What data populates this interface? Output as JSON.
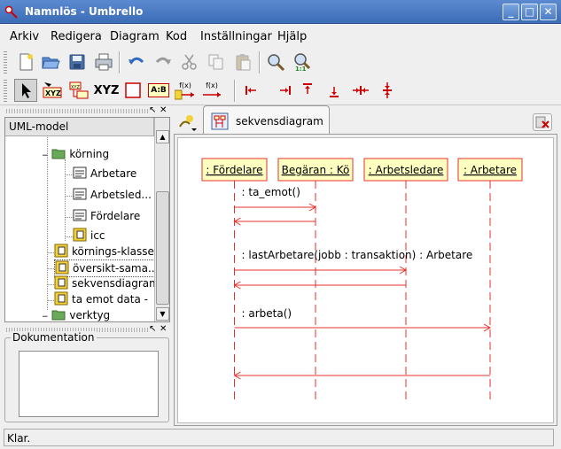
{
  "window": {
    "title": "Namnlös - Umbrello",
    "buttons": {
      "minimize": "_",
      "maximize": "□",
      "close": "✕"
    }
  },
  "menubar": {
    "items": [
      {
        "label": "Arkiv"
      },
      {
        "label": "Redigera"
      },
      {
        "label": "Diagram"
      },
      {
        "label": "Kod"
      },
      {
        "label": "Inställningar"
      },
      {
        "label": "Hjälp"
      }
    ]
  },
  "toolbar2": {
    "text_tool_label": "XYZ",
    "fx1": "f(x)",
    "fx2": "f(x)",
    "ab_label": "A:B"
  },
  "tree": {
    "header": "UML-model",
    "items": [
      {
        "label": "körning"
      },
      {
        "label": "Arbetare"
      },
      {
        "label": "Arbetsled..."
      },
      {
        "label": "Fördelare"
      },
      {
        "label": "icc"
      },
      {
        "label": "körnings-klassen"
      },
      {
        "label": "översikt-sama..."
      },
      {
        "label": "sekvensdiagram"
      },
      {
        "label": "ta emot data -"
      },
      {
        "label": "verktyg"
      }
    ]
  },
  "documentation": {
    "label": "Dokumentation",
    "value": ""
  },
  "tabs": [
    {
      "label": "sekvensdiagram"
    }
  ],
  "diagram": {
    "objects": [
      {
        "label": ": Fördelare"
      },
      {
        "label": "Begäran : Kö"
      },
      {
        "label": ": Arbetsledare"
      },
      {
        "label": ": Arbetare"
      }
    ],
    "messages": [
      {
        "label": ": ta_emot()"
      },
      {
        "label": ": lastArbetare(jobb : transaktion) : Arbetare"
      },
      {
        "label": ": arbeta()"
      }
    ],
    "colors": {
      "object_fill": "#ffffc0",
      "line": "#e8302b",
      "text": "#000000"
    }
  },
  "status": {
    "text": "Klar."
  }
}
